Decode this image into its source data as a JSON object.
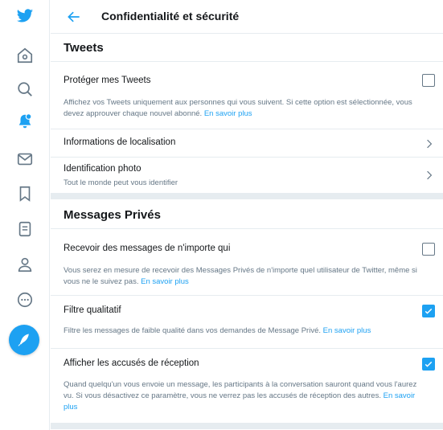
{
  "header": {
    "title": "Confidentialité et sécurité"
  },
  "sidebar": {
    "icons": [
      "twitter-logo",
      "home-icon",
      "explore-icon",
      "notifications-icon",
      "messages-icon",
      "bookmarks-icon",
      "lists-icon",
      "profile-icon",
      "more-icon"
    ],
    "compose_icon": "compose-tweet-icon"
  },
  "sections": {
    "tweets": {
      "title": "Tweets",
      "protect": {
        "label": "Protéger mes Tweets",
        "desc": "Affichez vos Tweets uniquement aux personnes qui vous suivent. Si cette option est sélectionnée, vous devez approuver chaque nouvel abonné.",
        "link": "En savoir plus",
        "checked": false
      },
      "location": {
        "label": "Informations de localisation"
      },
      "photo_tagging": {
        "label": "Identification photo",
        "sub": "Tout le monde peut vous identifier"
      }
    },
    "dm": {
      "title": "Messages Privés",
      "receive_any": {
        "label": "Recevoir des messages de n'importe qui",
        "desc": "Vous serez en mesure de recevoir des Messages Privés de n'importe quel utilisateur de Twitter, même si vous ne le suivez pas.",
        "link": "En savoir plus",
        "checked": false
      },
      "quality_filter": {
        "label": "Filtre qualitatif",
        "desc": "Filtre les messages de faible qualité dans vos demandes de Message Privé.",
        "link": "En savoir plus",
        "checked": true
      },
      "read_receipts": {
        "label": "Afficher les accusés de réception",
        "desc": "Quand quelqu'un vous envoie un message, les participants à la conversation sauront quand vous l'aurez vu. Si vous désactivez ce paramètre, vous ne verrez pas les accusés de réception des autres.",
        "link": "En savoir plus",
        "checked": true
      }
    }
  },
  "colors": {
    "accent": "#1da1f2",
    "border": "#e6ecf0",
    "secondary_text": "#657786"
  }
}
